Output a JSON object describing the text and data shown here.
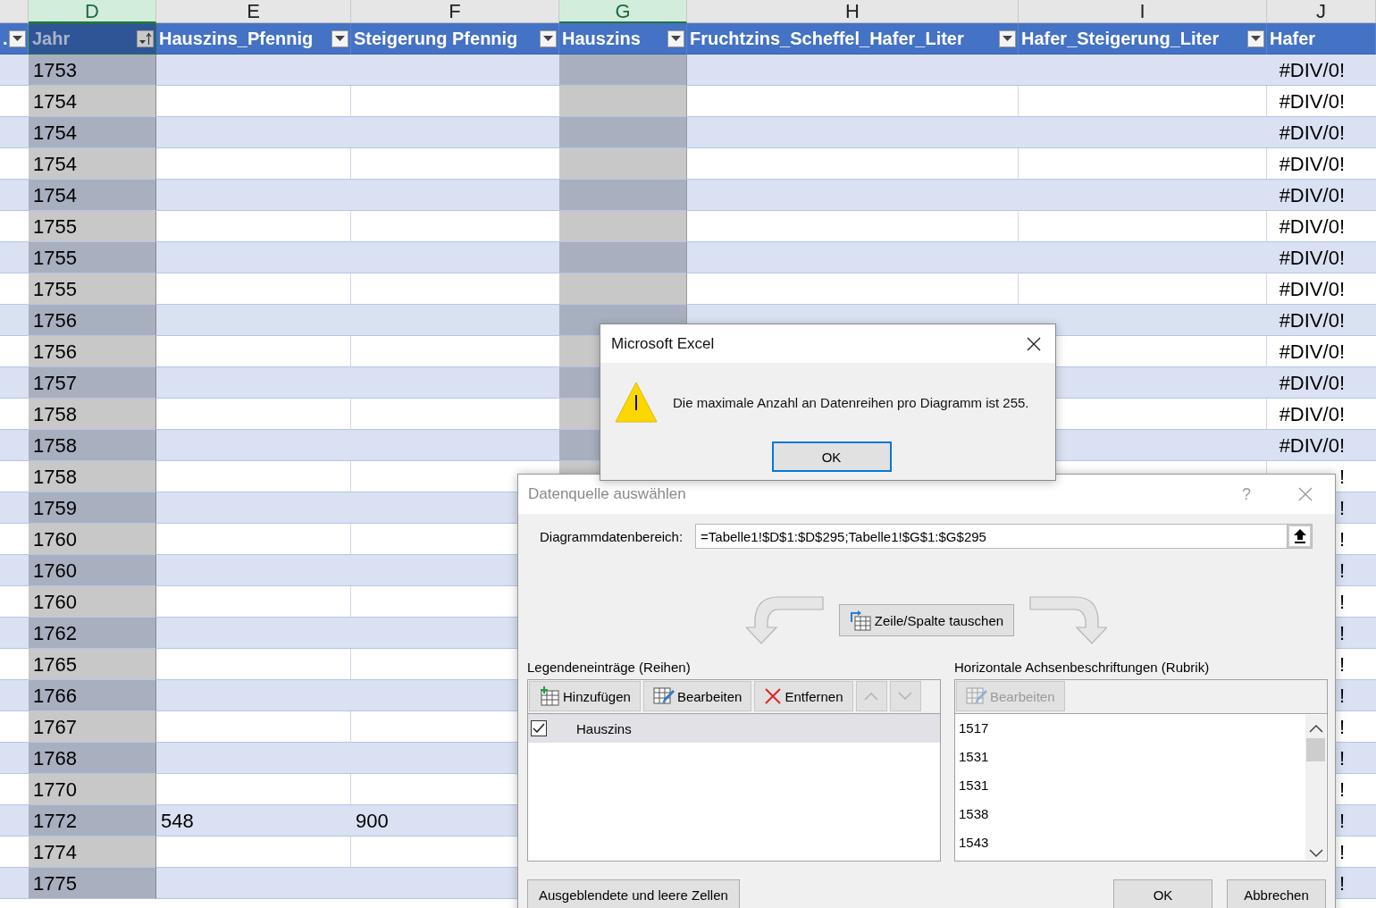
{
  "column_letters": [
    {
      "label": "D",
      "selected": true
    },
    {
      "label": "E",
      "selected": false
    },
    {
      "label": "F",
      "selected": false
    },
    {
      "label": "G",
      "selected": true
    },
    {
      "label": "H",
      "selected": false
    },
    {
      "label": "I",
      "selected": false
    },
    {
      "label": "J",
      "selected": false
    }
  ],
  "table": {
    "columns": [
      {
        "label": ".",
        "filter": true,
        "active": false
      },
      {
        "label": "Jahr",
        "filter": true,
        "sorted": true,
        "active": true
      },
      {
        "label": "Hauszins_Pfennig",
        "filter": true,
        "active": false
      },
      {
        "label": "Steigerung Pfennig",
        "filter": true,
        "active": false
      },
      {
        "label": "Hauszins",
        "filter": true,
        "active": false
      },
      {
        "label": "Fruchtzins_Scheffel_Hafer_Liter",
        "filter": true,
        "active": false
      },
      {
        "label": "Hafer_Steigerung_Liter",
        "filter": true,
        "active": false
      },
      {
        "label": "Hafer",
        "filter": false,
        "active": false
      }
    ],
    "rows": [
      {
        "jahr": "1753",
        "hafer": "#DIV/0!"
      },
      {
        "jahr": "1754",
        "hafer": "#DIV/0!"
      },
      {
        "jahr": "1754",
        "hafer": "#DIV/0!"
      },
      {
        "jahr": "1754",
        "hafer": "#DIV/0!"
      },
      {
        "jahr": "1754",
        "hafer": "#DIV/0!"
      },
      {
        "jahr": "1755",
        "hafer": "#DIV/0!"
      },
      {
        "jahr": "1755",
        "hafer": "#DIV/0!"
      },
      {
        "jahr": "1755",
        "hafer": "#DIV/0!"
      },
      {
        "jahr": "1756",
        "hafer": "#DIV/0!"
      },
      {
        "jahr": "1756",
        "hafer": "#DIV/0!"
      },
      {
        "jahr": "1757",
        "hafer": "#DIV/0!"
      },
      {
        "jahr": "1758",
        "hafer": "#DIV/0!"
      },
      {
        "jahr": "1758",
        "hafer": "#DIV/0!"
      },
      {
        "jahr": "1758",
        "hafer": "!"
      },
      {
        "jahr": "1759",
        "hafer": "!"
      },
      {
        "jahr": "1760",
        "hafer": "!"
      },
      {
        "jahr": "1760",
        "hafer": "!"
      },
      {
        "jahr": "1760",
        "hafer": "!"
      },
      {
        "jahr": "1762",
        "hafer": "!"
      },
      {
        "jahr": "1765",
        "hafer": "!"
      },
      {
        "jahr": "1766",
        "hafer": "!"
      },
      {
        "jahr": "1767",
        "hafer": "!"
      },
      {
        "jahr": "1768",
        "hafer": "!"
      },
      {
        "jahr": "1770",
        "hafer": "!"
      },
      {
        "jahr": "1772",
        "hauszins_pfennig": "548",
        "steigerung_pfennig": "900",
        "hafer": "!"
      },
      {
        "jahr": "1774",
        "hafer": "!"
      },
      {
        "jahr": "1775",
        "hafer": "!"
      }
    ]
  },
  "data_source_dialog": {
    "title": "Datenquelle auswählen",
    "help": "?",
    "range_label": "Diagrammdatenbereich:",
    "range_value": "=Tabelle1!$D$1:$D$295;Tabelle1!$G$1:$G$295",
    "switch_button": "Zeile/Spalte tauschen",
    "legend": {
      "label": "Legendeneinträge (Reihen)",
      "toolbar": [
        {
          "kind": "add",
          "label": "Hinzufügen",
          "disabled": false
        },
        {
          "kind": "edit",
          "label": "Bearbeiten",
          "disabled": false
        },
        {
          "kind": "remove",
          "label": "Entfernen",
          "disabled": false
        },
        {
          "kind": "up",
          "disabled": true
        },
        {
          "kind": "down",
          "disabled": true
        }
      ],
      "series": [
        {
          "label": "Hauszins",
          "checked": true,
          "selected": true
        }
      ]
    },
    "axis": {
      "label": "Horizontale Achsenbeschriftungen (Rubrik)",
      "toolbar": [
        {
          "kind": "edit",
          "label": "Bearbeiten",
          "disabled": true
        }
      ],
      "items": [
        "1517",
        "1531",
        "1531",
        "1538",
        "1543"
      ]
    },
    "buttons": [
      {
        "kind": "left",
        "label": "Ausgeblendete und leere Zellen"
      },
      {
        "kind": "right",
        "label": "OK"
      },
      {
        "kind": "right",
        "label": "Abbrechen"
      }
    ]
  },
  "message_box": {
    "title": "Microsoft Excel",
    "message": "Die maximale Anzahl an Datenreihen pro Diagramm ist 255.",
    "buttons": [
      {
        "label": "OK",
        "focused": true
      }
    ]
  }
}
